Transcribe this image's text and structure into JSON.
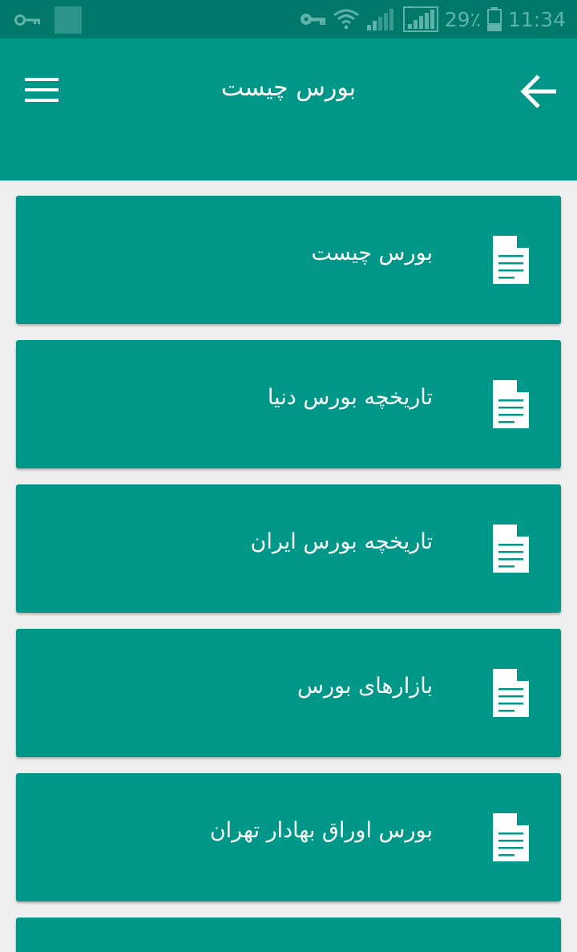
{
  "status_bar": {
    "signal_percent": "29٪",
    "time": "11:34",
    "icons": [
      "key-icon",
      "notification-square",
      "vpn-key-icon",
      "wifi-icon",
      "signal-icon",
      "signal-icon-2",
      "battery-icon"
    ]
  },
  "app_bar": {
    "title": "بورس چیست",
    "menu_icon": "hamburger-menu-icon",
    "back_icon": "arrow-back-icon",
    "color": "#009688"
  },
  "list": {
    "item_icon": "document-icon",
    "items": [
      {
        "label": "بورس چیست"
      },
      {
        "label": "تاریخچه بورس دنیا"
      },
      {
        "label": "تاریخچه بورس ایران"
      },
      {
        "label": "بازارهای بورس"
      },
      {
        "label": "بورس اوراق بهادار تهران"
      },
      {
        "label": ""
      }
    ]
  },
  "colors": {
    "status_bar": "#00796b",
    "primary": "#009688",
    "background": "#efefef",
    "text": "#ffffff"
  }
}
